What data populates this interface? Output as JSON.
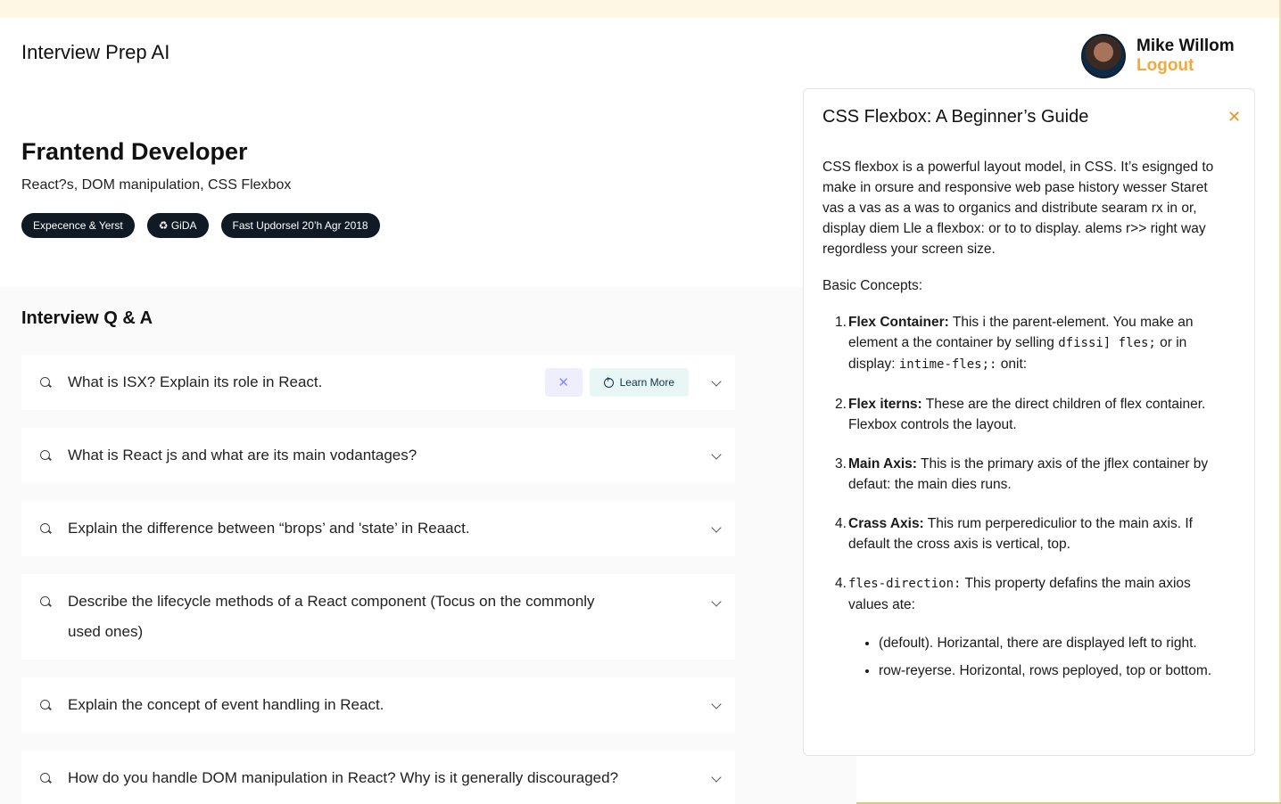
{
  "app": {
    "title": "Interview Prep AI"
  },
  "user": {
    "name": "Mike Willom",
    "logout_label": "Logout"
  },
  "role": {
    "title": "Frantend Developer",
    "topics": "React?s, DOM manipulation, CSS Flexbox",
    "badges": [
      "Expecence & Yerst",
      "♻ GiDA",
      "Fast Updorsel 20’h Agr 2018"
    ]
  },
  "qa": {
    "heading": "Interview Q & A",
    "learn_more_label": "Learn More",
    "pin_symbol": "✕",
    "questions": [
      "What is ISX? Explain its role in React.",
      "What is React js and what are its main vodantages?",
      "Explain the difference between “brops’ and 'state’ in Reaact.",
      "Describe the lifecycle methods of a React component (Tocus on the commonly used ones)",
      "Explain the concept of event handling in React.",
      "How do you handle DOM manipulation in React? Why is it generally discouraged?"
    ]
  },
  "panel": {
    "title": "CSS Flexbox: A Beginner’s Guide",
    "close_symbol": "✕",
    "intro": "CSS flexbox is a powerful layout model, in CSS. It’s esignged to make in orsure and responsive web pase history wesser Staret vas a vas as a was to organics and distribute searam rx in or, display diem Lle a flexbox: or to to display. alems r>> right way regordless your screen size.",
    "subhead": "Basic Concepts:",
    "concepts": [
      {
        "num": "1.",
        "term": "Flex Container:",
        "text": " This i the parent-element. You make an element a the container by selling ",
        "code": "dfissi] fles;",
        "text2": " or in display: ",
        "code2": "intime-fles;:",
        "text3": " onit:"
      },
      {
        "num": "2.",
        "term": "Flex iterns:",
        "text": " These are the direct children  of flex container. Flexbox controls the layout."
      },
      {
        "num": "3.",
        "term": "Main Axis:",
        "text": " This is the primary axis of the jflex container by defaut: the main dies runs."
      },
      {
        "num": "4.",
        "term": "Crass Axis:",
        "text": " This rum perperediculior to the main axis. If default the cross axis is vertical, top."
      },
      {
        "num": "4.",
        "code": "fles-direction:",
        "text": " This property defafins the main axios values ate:"
      }
    ],
    "sub_items": [
      {
        "term": "(defoult).",
        "text": " Horizantal, there are displayed left to right."
      },
      {
        "term": "row-reyerse.",
        "text": "  Horizontal, rows peployed, top or bottom."
      }
    ]
  },
  "colors": {
    "accent": "#f2a93b",
    "badge_bg": "#0f1a24",
    "pin_bg": "#eeeefd",
    "learn_bg": "#e9f6f6"
  },
  "icons": [
    "search-icon",
    "chevron-down-icon",
    "close-icon",
    "pin-icon",
    "plus-circle-icon"
  ]
}
